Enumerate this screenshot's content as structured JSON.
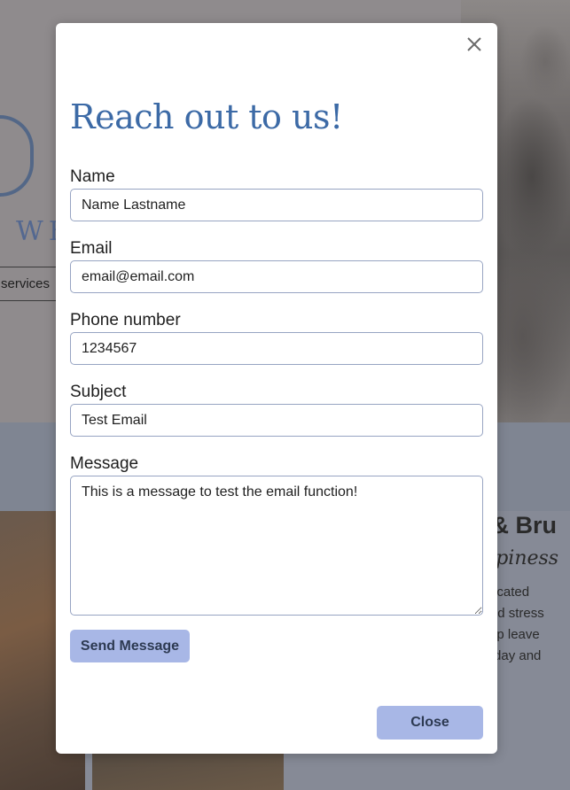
{
  "background": {
    "nav_item": "services",
    "logo_text": "WE",
    "heading": "k & Bru",
    "subheading": "appiness",
    "paragraph_lines": [
      "dedicated",
      "g and stress",
      "y pup leave",
      "n today and"
    ]
  },
  "modal": {
    "title": "Reach out to us!",
    "fields": {
      "name": {
        "label": "Name",
        "value": "Name Lastname"
      },
      "email": {
        "label": "Email",
        "value": "email@email.com"
      },
      "phone": {
        "label": "Phone number",
        "value": "1234567"
      },
      "subject": {
        "label": "Subject",
        "value": "Test Email"
      },
      "message": {
        "label": "Message",
        "value": "This is a message to test the email function!"
      }
    },
    "send_label": "Send Message",
    "close_label": "Close"
  },
  "colors": {
    "title": "#3c6aa6",
    "button_bg": "#a8b7e6",
    "input_border": "#97a4c2",
    "overlay": "#8e8b8d"
  },
  "icons": {
    "close": "close-icon"
  }
}
